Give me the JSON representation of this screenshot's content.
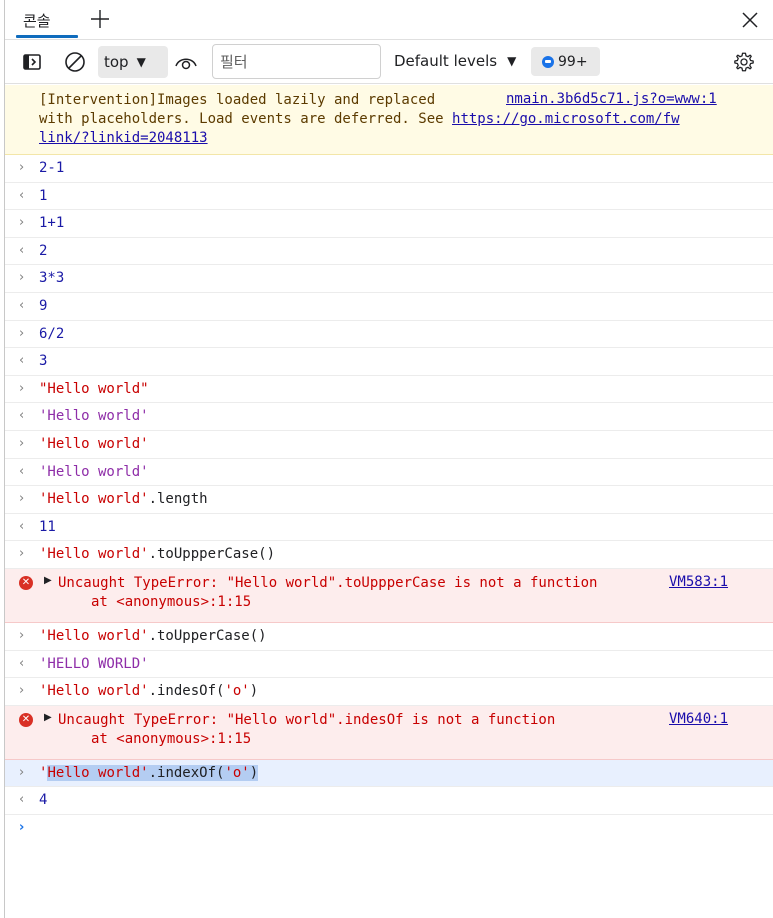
{
  "tabs": {
    "console_label": "콘솔"
  },
  "toolbar": {
    "context": "top",
    "filter_placeholder": "필터",
    "levels": "Default levels",
    "issues_count": "99+"
  },
  "console": {
    "warning": {
      "line1": "[Intervention]Images loaded lazily and replaced",
      "line2": "with placeholders. Load events are deferred. See ",
      "link_a": "https://go.microsoft.com/fw",
      "link_b": "link/?linkid=2048113",
      "source": "nmain.3b6d5c71.js?o=www:1"
    },
    "entries": [
      {
        "kind": "in",
        "text": "2-1"
      },
      {
        "kind": "out",
        "text": "1"
      },
      {
        "kind": "in",
        "text": "1+1"
      },
      {
        "kind": "out",
        "text": "2"
      },
      {
        "kind": "in",
        "text": "3*3"
      },
      {
        "kind": "out",
        "text": "9"
      },
      {
        "kind": "in",
        "text": "6/2"
      },
      {
        "kind": "out",
        "text": "3"
      },
      {
        "kind": "in",
        "text": "\"Hello world\""
      },
      {
        "kind": "out",
        "text": "'Hello world'"
      },
      {
        "kind": "in",
        "text": "'Hello world'"
      },
      {
        "kind": "out",
        "text": "'Hello world'"
      },
      {
        "kind": "in",
        "text": "'Hello world'.length"
      },
      {
        "kind": "out",
        "text": "11"
      },
      {
        "kind": "in",
        "text": "'Hello world'.toUppperCase()"
      }
    ],
    "error1": {
      "message": "Uncaught TypeError: \"Hello world\".toUppperCase is not a function",
      "trace": "at <anonymous>:1:15",
      "source": "VM583:1"
    },
    "entries2": [
      {
        "kind": "in",
        "text": "'Hello world'.toUpperCase()"
      },
      {
        "kind": "out",
        "text": "'HELLO WORLD'"
      },
      {
        "kind": "in",
        "text": "'Hello world'.indesOf('o')"
      }
    ],
    "error2": {
      "message": "Uncaught TypeError: \"Hello world\".indesOf is not a function",
      "trace": "at <anonymous>:1:15",
      "source": "VM640:1"
    },
    "active_input": {
      "quote": "'",
      "selected": "Hello world",
      "rest_pre": "'.indexOf(",
      "arg": "'o'",
      "close": ")"
    },
    "last_output": "4"
  }
}
